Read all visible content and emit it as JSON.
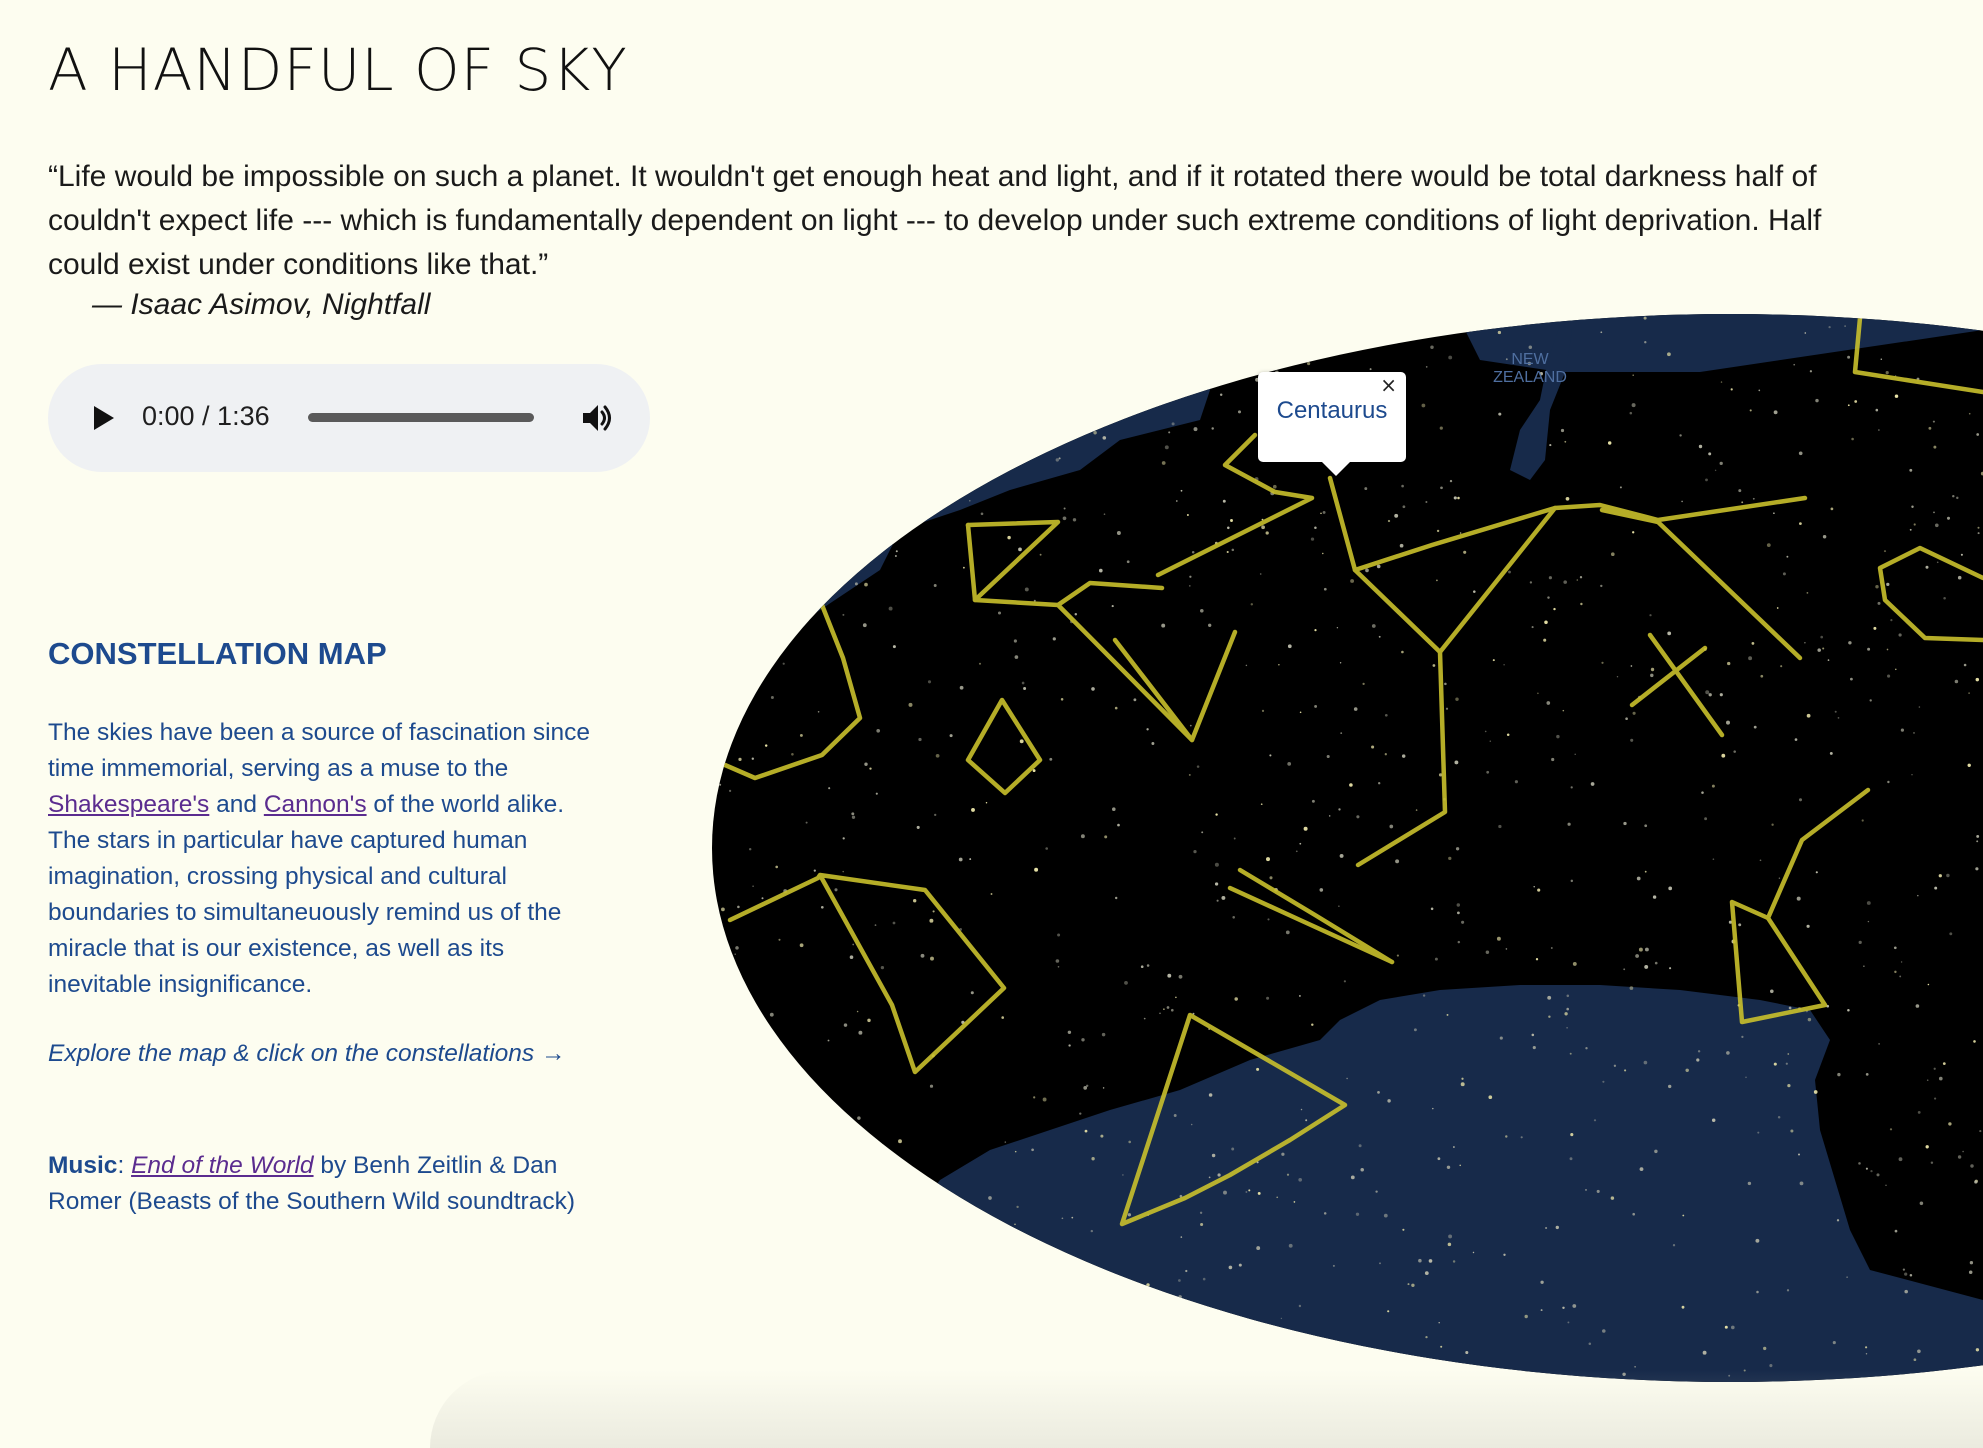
{
  "page": {
    "title": "A HANDFUL OF SKY",
    "quote_lines": [
      "“Life would be impossible on such a planet. It wouldn't get enough heat and light, and if it rotated there would be total darkness half of",
      "couldn't expect life --- which is fundamentally dependent on light --- to develop under such extreme conditions of light deprivation. Half",
      "could exist under conditions like that.”"
    ],
    "attribution": "— Isaac Asimov, Nightfall"
  },
  "player": {
    "time": "0:00 / 1:36",
    "progress": 0,
    "play_icon": "play-icon",
    "volume_icon": "volume-icon"
  },
  "sidebar": {
    "heading": "CONSTELLATION MAP",
    "intro_1": "The skies have been a source of fascination since",
    "intro_2": "time immemorial, serving as a muse to the",
    "link_1": "Shakespeare's",
    "and": "and",
    "link_2": "Cannon's",
    "intro_3_tail": "of the world alike.",
    "intro_4": "The stars in particular have captured human",
    "intro_5": "imagination, crossing physical and cultural",
    "intro_6": "boundaries to simultaneuously remind us of the",
    "intro_7": "miracle that is our existence, as well as its",
    "intro_8": "inevitable insignificance.",
    "explore": "Explore the map & click on the constellations →",
    "music_label": "Music",
    "music_colon": ":",
    "music_title": "End of the World",
    "music_by": "by Benh Zeitlin & Dan",
    "music_rest": "Romer (Beasts of the Southern Wild soundtrack)"
  },
  "map": {
    "region_label_line1": "NEW",
    "region_label_line2": "ZEALAND",
    "popup_name": "Centaurus",
    "popup_close": "×",
    "colors": {
      "sky": "#000000",
      "ocean": "#172a4a",
      "constellation": "#c9c02c",
      "label": "#4f6fa0"
    }
  }
}
